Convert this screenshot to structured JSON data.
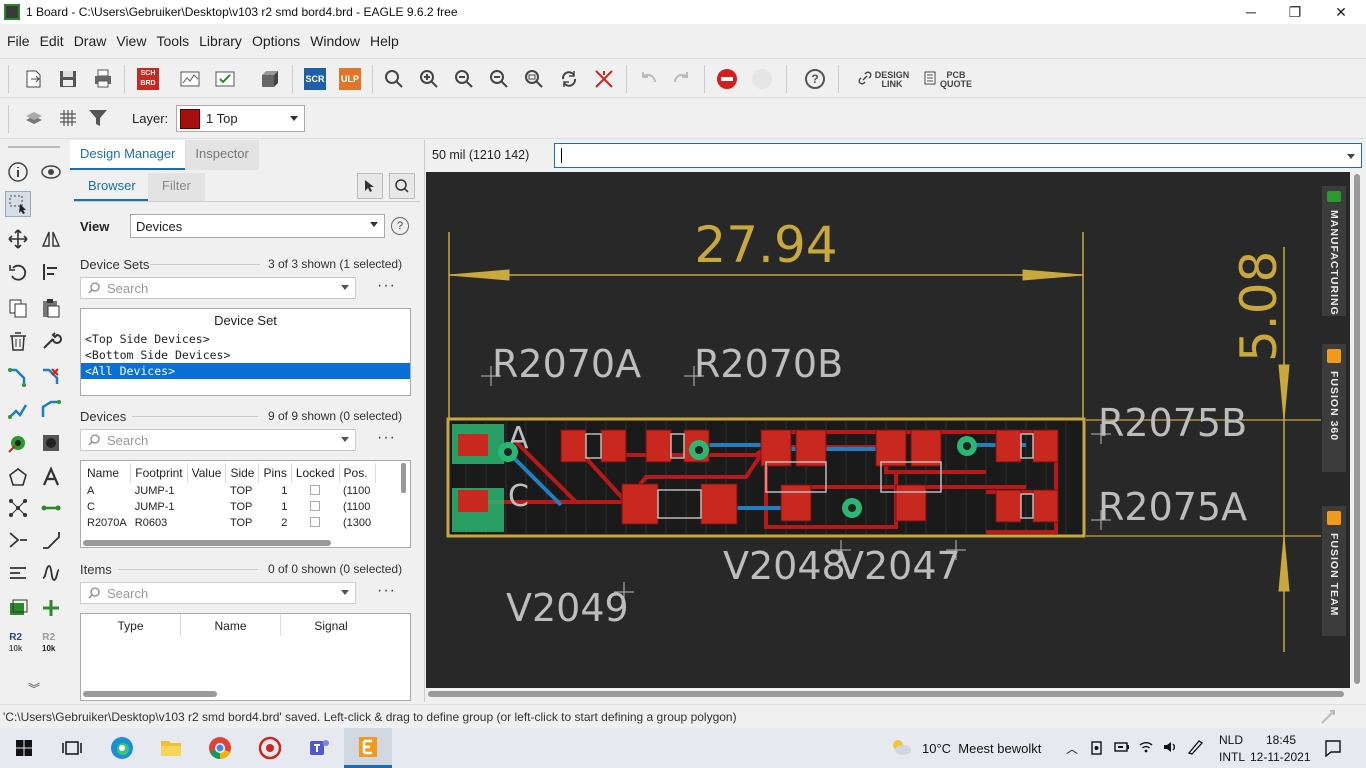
{
  "window": {
    "title": "1 Board - C:\\Users\\Gebruiker\\Desktop\\v103 r2 smd bord4.brd - EAGLE 9.6.2 free",
    "minimize": "─",
    "maximize": "❐",
    "close": "✕"
  },
  "menu": [
    "File",
    "Edit",
    "Draw",
    "View",
    "Tools",
    "Library",
    "Options",
    "Window",
    "Help"
  ],
  "toolbar": {
    "sch_brd": "SCH BRD",
    "scr": "SCR",
    "ulp": "ULP",
    "design_link": "DESIGN LINK",
    "pcb_quote": "PCB QUOTE",
    "help": "?"
  },
  "layerbar": {
    "label": "Layer:",
    "layer": "1 Top",
    "layer_color": "#a50f0f"
  },
  "design_manager": {
    "tabs": [
      "Design Manager",
      "Inspector"
    ],
    "subtabs": [
      "Browser",
      "Filter"
    ],
    "view_label": "View",
    "view_value": "Devices",
    "device_sets": {
      "title": "Device Sets",
      "count": "3 of 3 shown (1 selected)",
      "search_placeholder": "Search",
      "header": "Device Set",
      "items": [
        "<Top Side Devices>",
        "<Bottom Side Devices>",
        "<All Devices>"
      ],
      "selected_index": 2
    },
    "devices": {
      "title": "Devices",
      "count": "9 of 9 shown (0 selected)",
      "search_placeholder": "Search",
      "columns": [
        "Name",
        "Footprint",
        "Value",
        "Side",
        "Pins",
        "Locked",
        "Pos."
      ],
      "rows": [
        {
          "name": "A",
          "footprint": "JUMP-1",
          "value": "",
          "side": "TOP",
          "pins": "1",
          "pos": "(1100"
        },
        {
          "name": "C",
          "footprint": "JUMP-1",
          "value": "",
          "side": "TOP",
          "pins": "1",
          "pos": "(1100"
        },
        {
          "name": "R2070A",
          "footprint": "R0603",
          "value": "",
          "side": "TOP",
          "pins": "2",
          "pos": "(1300"
        }
      ]
    },
    "items": {
      "title": "Items",
      "count": "0 of 0 shown (0 selected)",
      "search_placeholder": "Search",
      "columns": [
        "Type",
        "Name",
        "Signal"
      ]
    }
  },
  "command": {
    "coordinates": "50 mil (1210 142)",
    "value": ""
  },
  "canvas": {
    "dimension_h": "27.94",
    "dimension_v": "5.08",
    "labels": [
      "R2070A",
      "R2070B",
      "R2075B",
      "R2075A",
      "V2048",
      "V2047",
      "V2049"
    ],
    "pad_labels": [
      "A",
      "C"
    ],
    "side_tabs": [
      "MANUFACTURING",
      "FUSION 360",
      "FUSION TEAM"
    ]
  },
  "palette": {
    "r2_label": "R2",
    "r2_value": "10k"
  },
  "status": {
    "text": "'C:\\Users\\Gebruiker\\Desktop\\v103 r2 smd bord4.brd' saved. Left-click & drag to define group (or left-click to start defining a group polygon)"
  },
  "taskbar": {
    "weather": "10°C  Meest bewolkt",
    "lang_top": "NLD",
    "lang_bottom": "INTL",
    "time": "18:45",
    "date": "12-11-2021"
  }
}
